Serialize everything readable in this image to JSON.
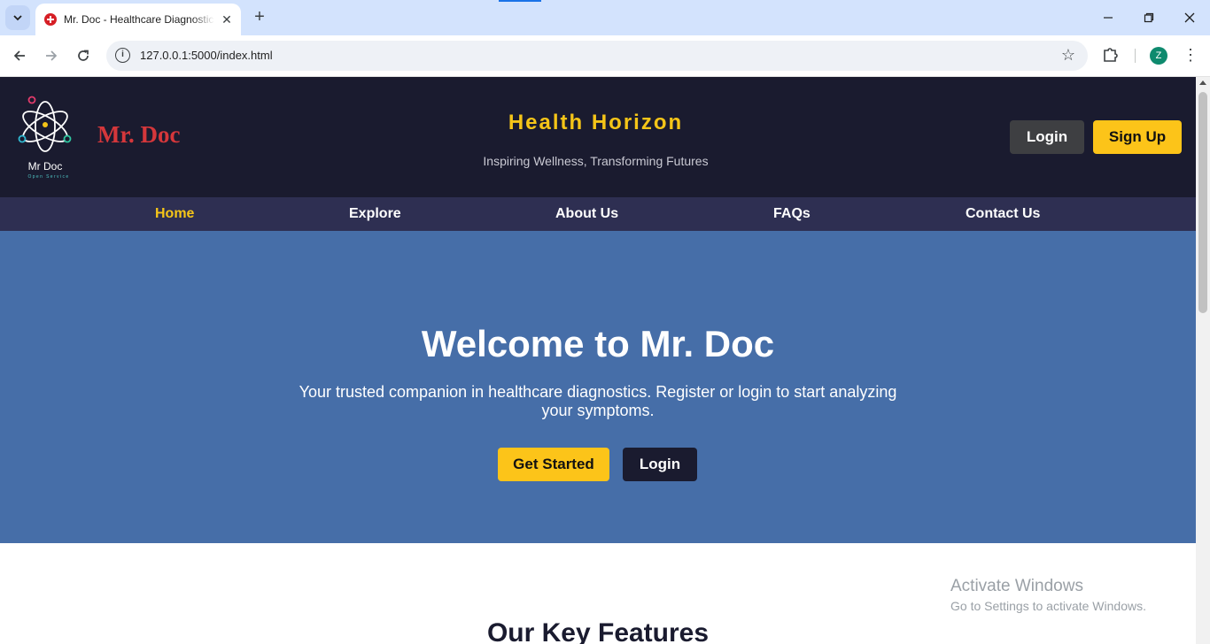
{
  "browser": {
    "tab_title": "Mr. Doc - Healthcare Diagnostics",
    "url": "127.0.0.1:5000/index.html",
    "profile_initial": "Z",
    "icons": {
      "tab_list": "chevron-down-icon",
      "close": "close-icon",
      "new_tab": "plus-icon",
      "back": "arrow-left-icon",
      "forward": "arrow-right-icon",
      "reload": "reload-icon",
      "site_info": "info-icon",
      "bookmark": "star-icon",
      "extensions": "puzzle-icon",
      "menu": "more-vertical-icon"
    }
  },
  "header": {
    "logo_text": "Mr Doc",
    "logo_subtext": "Open Service",
    "brand": "Mr. Doc",
    "title": "Health Horizon",
    "tagline": "Inspiring Wellness, Transforming Futures",
    "login_label": "Login",
    "signup_label": "Sign Up"
  },
  "nav": {
    "items": [
      {
        "label": "Home",
        "active": true
      },
      {
        "label": "Explore",
        "active": false
      },
      {
        "label": "About Us",
        "active": false
      },
      {
        "label": "FAQs",
        "active": false
      },
      {
        "label": "Contact Us",
        "active": false
      }
    ]
  },
  "hero": {
    "title": "Welcome to Mr. Doc",
    "text": "Your trusted companion in healthcare diagnostics. Register or login to start analyzing your symptoms.",
    "get_started_label": "Get Started",
    "login_label": "Login"
  },
  "features": {
    "title": "Our Key Features"
  },
  "watermark": {
    "line1": "Activate Windows",
    "line2": "Go to Settings to activate Windows."
  },
  "colors": {
    "header_bg": "#1a1b2f",
    "nav_bg": "#2e2f52",
    "hero_bg": "#466ea8",
    "accent_yellow": "#f5c518",
    "brand_red": "#d5373b"
  }
}
